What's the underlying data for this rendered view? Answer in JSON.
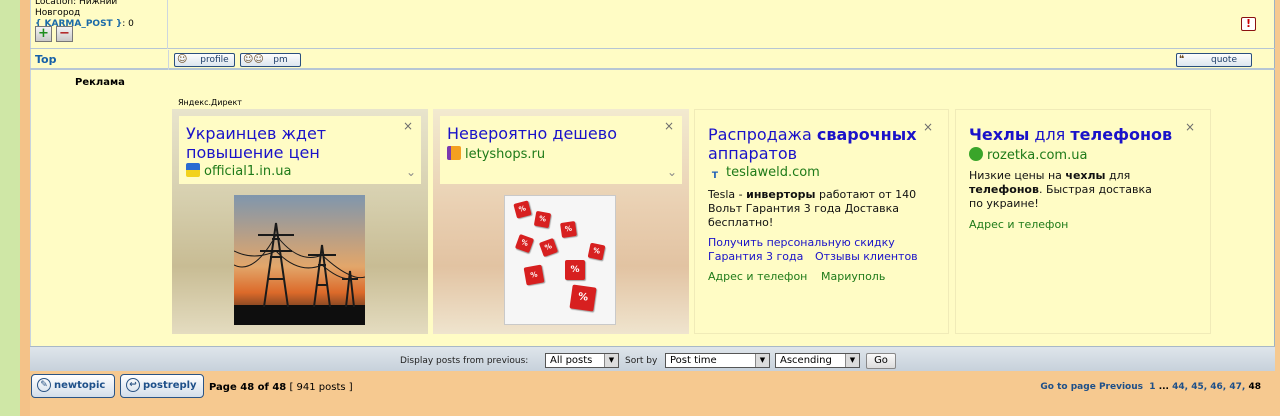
{
  "post": {
    "location_label": "Location: Нижний",
    "location_line2": "Новгород",
    "karma_label": "{ KARMA_POST }",
    "karma_value": ": 0",
    "plus_label": "+",
    "minus_label": "−",
    "report_label": "!"
  },
  "actions": {
    "top_link": "Top",
    "profile_label": "profile",
    "pm_label": "pm",
    "quote_label": "quote"
  },
  "ads": {
    "section_title": "Реклама",
    "provider": "Яндекс.Директ",
    "cards": [
      {
        "headline": "Украинцев ждет повышение цен",
        "domain": "official1.in.ua"
      },
      {
        "headline": "Невероятно дешево",
        "domain": "letyshops.ru"
      },
      {
        "headline_plain": "Распродажа ",
        "headline_bold": "сварочных",
        "headline_line2": "аппаратов",
        "domain": "teslaweld.com",
        "body_plain1": "Tesla - ",
        "body_bold": "инверторы",
        "body_plain2": " работают от 140",
        "body_line2": "Вольт Гарантия 3 года Доставка",
        "body_line3": "бесплатно!",
        "link1": "Получить персональную скидку",
        "link2a": "Гарантия 3 года",
        "link2b": "Отзывы клиентов",
        "green1": "Адрес и телефон",
        "green2": "Мариуполь"
      },
      {
        "headline_bold1": "Чехлы",
        "headline_plain": " для ",
        "headline_bold2": "телефонов",
        "domain": "rozetka.com.ua",
        "body_plain1": "Низкие цены на ",
        "body_bold1": "чехлы",
        "body_plain2": " для",
        "body_bold2": "телефонов",
        "body_plain3": ". Быстрая доставка",
        "body_line3": "по украине!",
        "green1": "Адрес и телефон"
      }
    ],
    "close_glyph": "×",
    "chevron_glyph": "⌄"
  },
  "controls": {
    "display_label": "Display posts from previous:",
    "display_value": "All posts",
    "sort_label": "Sort by",
    "sort_value": "Post time",
    "order_value": "Ascending",
    "go_label": "Go"
  },
  "footer": {
    "newtopic_label": "newtopic",
    "postreply_label": "postreply",
    "page_info": "Page 48 of 48",
    "posts_count": "[ 941 posts ]",
    "goto_label": "Go to page",
    "previous_label": "Previous",
    "page_1": "1",
    "ellipsis": "...",
    "page_44": "44,",
    "page_45": "45,",
    "page_46": "46,",
    "page_47": "47,",
    "page_48": "48"
  },
  "colors": {
    "background": "#f6c990",
    "panel": "#fffcc5",
    "link_blue": "#1a12c9",
    "link_green": "#1e7a19",
    "nav_blue": "#1d4f89"
  }
}
